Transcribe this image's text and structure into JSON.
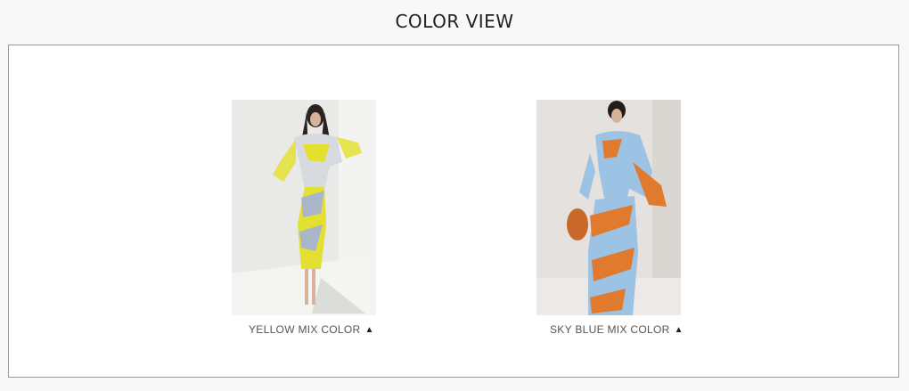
{
  "section": {
    "title": "COLOR VIEW"
  },
  "items": [
    {
      "label": "YELLOW MIX COLOR",
      "icon": "triangle-up-icon",
      "glyph": "▲",
      "accent": "#e3e032",
      "secondary": "#a9b6c8"
    },
    {
      "label": "SKY BLUE MIX COLOR",
      "icon": "triangle-up-icon",
      "glyph": "▲",
      "accent": "#e07a2f",
      "secondary": "#9cc3e3"
    }
  ]
}
